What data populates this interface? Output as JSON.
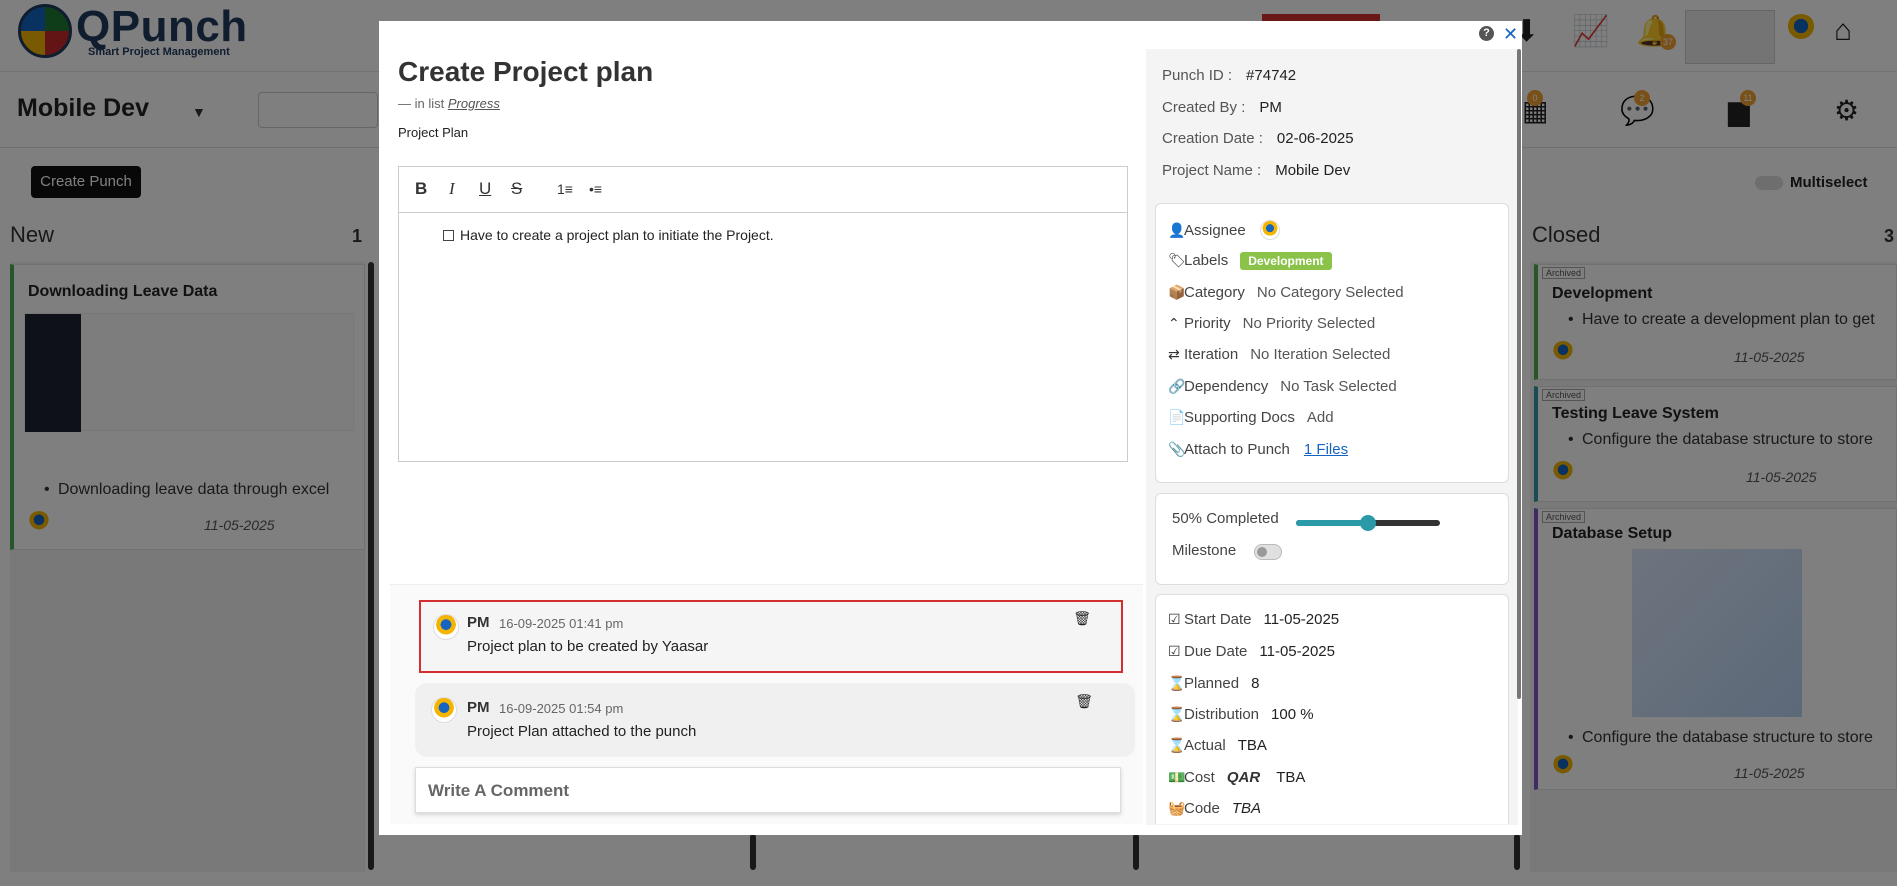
{
  "app": {
    "logo_text": "QPunch",
    "logo_sub": "Smart Project Management",
    "project_title": "Mobile Dev",
    "notif_count": "37",
    "create_punch_label": "Create Punch",
    "multiselect_label": "Multiselect",
    "sub_badges": [
      "0",
      "2",
      "11"
    ]
  },
  "columns": {
    "new": {
      "title": "New",
      "count": "1",
      "cards": [
        {
          "title": "Downloading Leave Data",
          "text": "Downloading leave data through excel",
          "date": "11-05-2025"
        }
      ]
    },
    "closed": {
      "title": "Closed",
      "count": "3",
      "cards": [
        {
          "tag": "Archived",
          "title": "Development",
          "text": "Have to create a development plan to get",
          "date": "11-05-2025"
        },
        {
          "tag": "Archived",
          "title": "Testing Leave System",
          "text": "Configure the database structure to store",
          "date": "11-05-2025"
        },
        {
          "tag": "Archived",
          "title": "Database Setup",
          "text": "Configure the database structure to store",
          "date": "11-05-2025"
        }
      ]
    }
  },
  "modal": {
    "title": "Create Project plan",
    "in_list_prefix": "—  in list",
    "in_list_name": "Progress",
    "doc_name": "Project Plan",
    "editor_text": "Have to create a project plan to initiate the Project.",
    "toolbar": {
      "bold": "B",
      "italic": "I",
      "underline": "U",
      "strike": "S",
      "ordered": "1≡",
      "bullet": "•≡"
    },
    "comments": [
      {
        "author": "PM",
        "time": "16-09-2025 01:41 pm",
        "text": "Project plan to be created by Yaasar"
      },
      {
        "author": "PM",
        "time": "16-09-2025 01:54 pm",
        "text": "Project Plan attached to the punch"
      }
    ],
    "write_comment_placeholder": "Write A Comment",
    "meta": {
      "punch_id_label": "Punch ID :",
      "punch_id": "#74742",
      "created_by_label": "Created By :",
      "created_by": "PM",
      "creation_date_label": "Creation Date :",
      "creation_date": "02-06-2025",
      "project_name_label": "Project Name :",
      "project_name": "Mobile Dev"
    },
    "props": {
      "assignee_label": "Assignee",
      "labels_label": "Labels",
      "label_value": "Development",
      "category_label": "Category",
      "category_value": "No Category Selected",
      "priority_label": "Priority",
      "priority_value": "No Priority Selected",
      "iteration_label": "Iteration",
      "iteration_value": "No Iteration Selected",
      "dependency_label": "Dependency",
      "dependency_value": "No Task Selected",
      "docs_label": "Supporting Docs",
      "docs_value": "Add",
      "attach_label": "Attach to Punch",
      "attach_value": "1 Files"
    },
    "progress": {
      "completed_label": "50% Completed",
      "percent": 50,
      "milestone_label": "Milestone"
    },
    "dates": {
      "start_label": "Start Date",
      "start_value": "11-05-2025",
      "due_label": "Due Date",
      "due_value": "11-05-2025",
      "planned_label": "Planned",
      "planned_value": "8",
      "distribution_label": "Distribution",
      "distribution_value": "100 %",
      "actual_label": "Actual",
      "actual_value": "TBA",
      "cost_label": "Cost",
      "cost_currency": "QAR",
      "cost_value": "TBA",
      "code_label": "Code",
      "code_value": "TBA"
    }
  },
  "colors": {
    "accent": "#2a9aa8",
    "label_green": "#8bc34a",
    "highlight_red": "#d32f2f",
    "link_blue": "#1565c0"
  }
}
